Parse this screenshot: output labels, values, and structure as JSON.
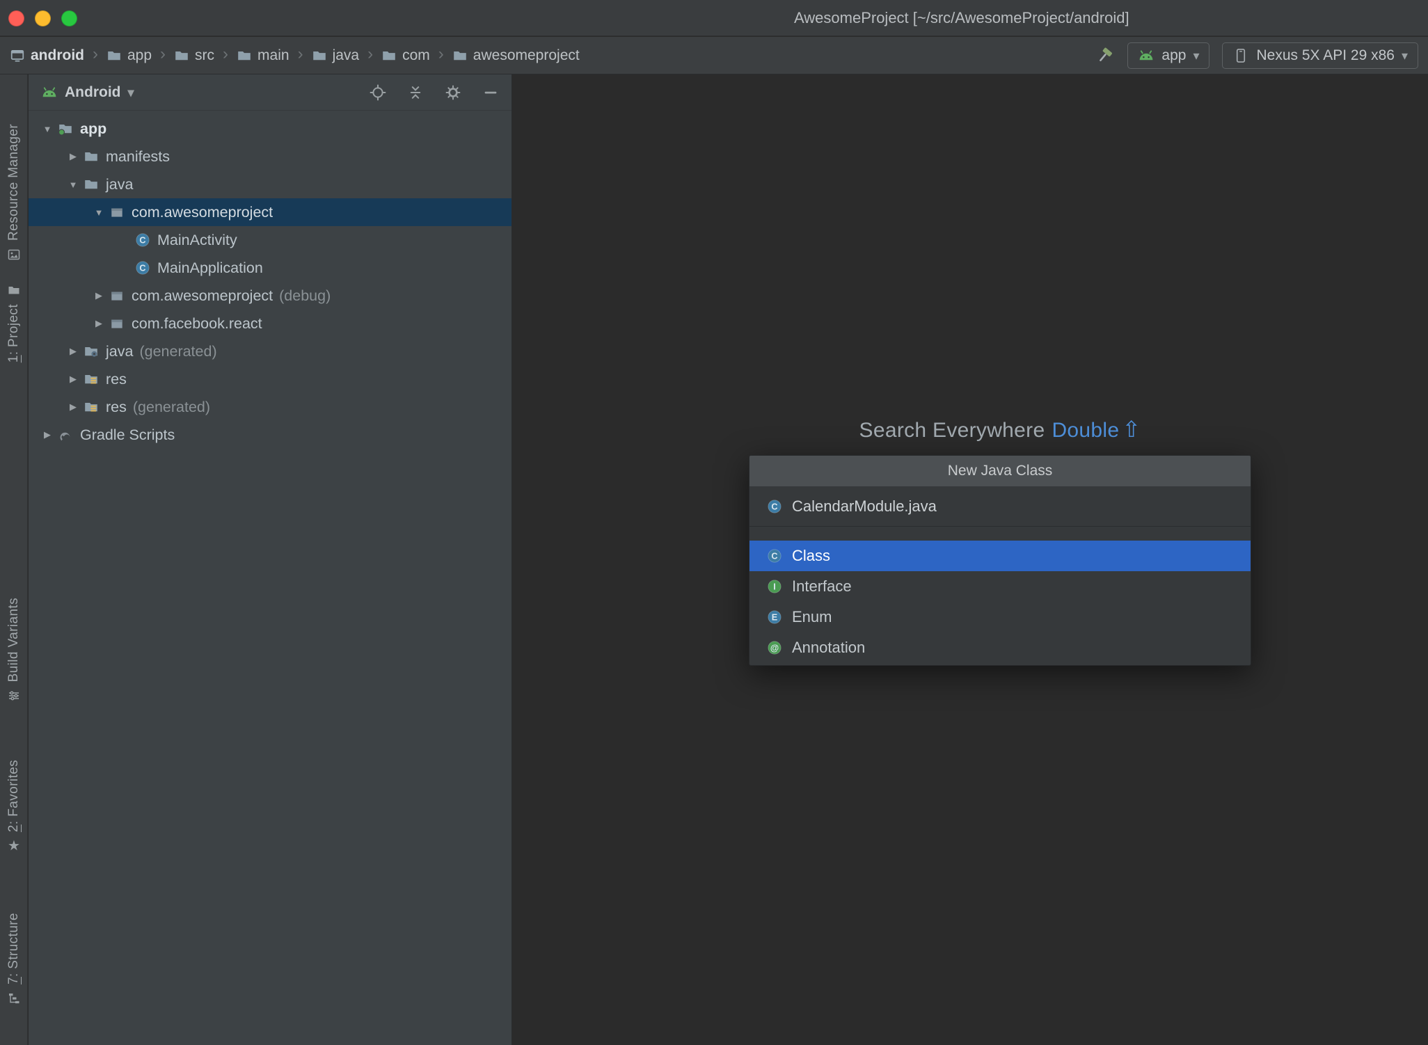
{
  "window": {
    "title": "AwesomeProject [~/src/AwesomeProject/android]"
  },
  "titlebar": {
    "traffic_lights": [
      {
        "name": "close",
        "color": "#ff5f57"
      },
      {
        "name": "minimize",
        "color": "#febc2e"
      },
      {
        "name": "zoom",
        "color": "#28c840"
      }
    ]
  },
  "toolbar": {
    "breadcrumbs": [
      {
        "label": "android",
        "icon": "module-icon",
        "bold": true
      },
      {
        "label": "app",
        "icon": "folder-icon"
      },
      {
        "label": "src",
        "icon": "folder-icon"
      },
      {
        "label": "main",
        "icon": "folder-icon"
      },
      {
        "label": "java",
        "icon": "folder-icon"
      },
      {
        "label": "com",
        "icon": "folder-icon"
      },
      {
        "label": "awesomeproject",
        "icon": "folder-icon"
      }
    ],
    "build_icon": "hammer-icon",
    "run_config": {
      "icon": "android-icon",
      "label": "app"
    },
    "device_selector": {
      "icon": "phone-icon",
      "label": "Nexus 5X API 29 x86"
    }
  },
  "stripe": {
    "buttons": [
      {
        "prefix": "",
        "label": "Resource Manager",
        "icon": "image-icon"
      },
      {
        "prefix": "1",
        "label": ": Project",
        "icon": "project-folder-icon"
      },
      {
        "prefix": "",
        "label": "Build Variants",
        "icon": "sliders-icon"
      },
      {
        "prefix": "2",
        "label": ": Favorites",
        "icon": "star-icon"
      },
      {
        "prefix": "7",
        "label": ": Structure",
        "icon": "structure-icon"
      }
    ]
  },
  "project_panel": {
    "header": {
      "view": "Android",
      "actions": [
        "locate-icon",
        "collapse-all-icon",
        "settings-gear-icon",
        "hide-icon"
      ]
    },
    "tree": [
      {
        "label": "app",
        "icon": "module-folder-icon",
        "arrow": "expanded",
        "level": 0,
        "bold": true
      },
      {
        "label": "manifests",
        "icon": "folder-icon",
        "arrow": "collapsed",
        "level": 1
      },
      {
        "label": "java",
        "icon": "folder-icon",
        "arrow": "expanded",
        "level": 1
      },
      {
        "label": "com.awesomeproject",
        "icon": "package-icon",
        "arrow": "expanded",
        "level": 2,
        "selected": true
      },
      {
        "label": "MainActivity",
        "icon": "class-icon",
        "level": 3
      },
      {
        "label": "MainApplication",
        "icon": "class-icon",
        "level": 3
      },
      {
        "label": "com.awesomeproject",
        "suffix": "(debug)",
        "icon": "package-icon",
        "arrow": "collapsed",
        "level": 2
      },
      {
        "label": "com.facebook.react",
        "icon": "package-icon",
        "arrow": "collapsed",
        "level": 2
      },
      {
        "label": "java",
        "suffix": "(generated)",
        "icon": "gen-folder-icon",
        "arrow": "collapsed",
        "level": 1
      },
      {
        "label": "res",
        "icon": "res-folder-icon",
        "arrow": "collapsed",
        "level": 1
      },
      {
        "label": "res",
        "suffix": "(generated)",
        "icon": "res-folder-icon",
        "arrow": "collapsed",
        "level": 1
      },
      {
        "label": "Gradle Scripts",
        "icon": "gradle-icon",
        "arrow": "collapsed",
        "level": 0
      }
    ]
  },
  "editor_hint": {
    "label": "Search Everywhere",
    "shortcut_label": "Double",
    "shortcut_key": "⇧"
  },
  "popup": {
    "title": "New Java Class",
    "filename": {
      "icon": "class-icon",
      "label": "CalendarModule.java"
    },
    "options": [
      {
        "label": "Class",
        "icon": "class-icon",
        "selected": true
      },
      {
        "label": "Interface",
        "icon": "interface-icon"
      },
      {
        "label": "Enum",
        "icon": "enum-icon"
      },
      {
        "label": "Annotation",
        "icon": "annotation-icon"
      }
    ]
  },
  "colors": {
    "selection_blue": "#2d65c4",
    "tree_selection_blue": "#173a57",
    "android_green": "#5fae61",
    "link_blue": "#4e8fd9"
  }
}
